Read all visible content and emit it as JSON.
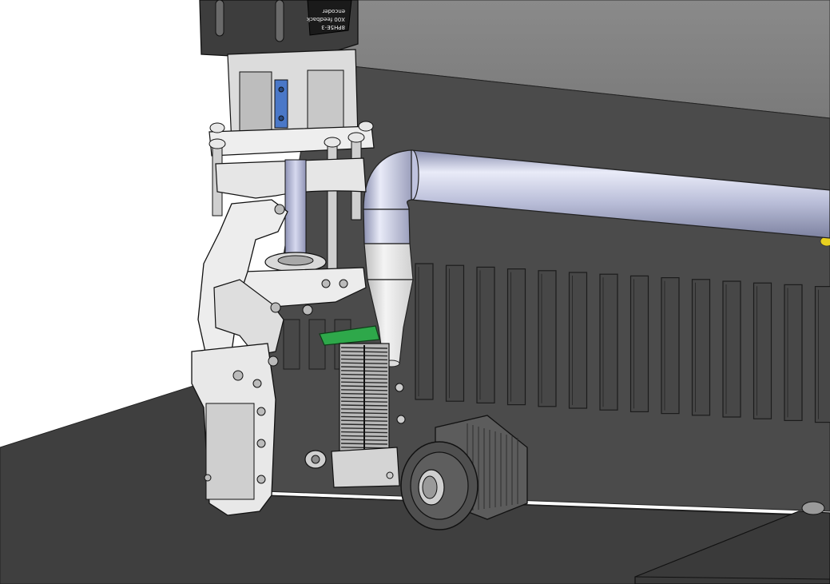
{
  "scene": {
    "motor_label": {
      "line1": "8PH5E-3",
      "line2": "X00 feedback",
      "line3": "encoder"
    },
    "colors": {
      "background": "#ffffff",
      "floor": "#404040",
      "back_wall": "#4a4a4a",
      "upper_wall": "#8c8c8c",
      "metal": "#e6e6e6",
      "edge": "#1a1a1a",
      "pipe": "#c9cde8",
      "pcb": "#2ea84a",
      "coupler": "#4a78c8",
      "gland": "#5a5a5a",
      "accent_yellow": "#e8d020"
    }
  }
}
